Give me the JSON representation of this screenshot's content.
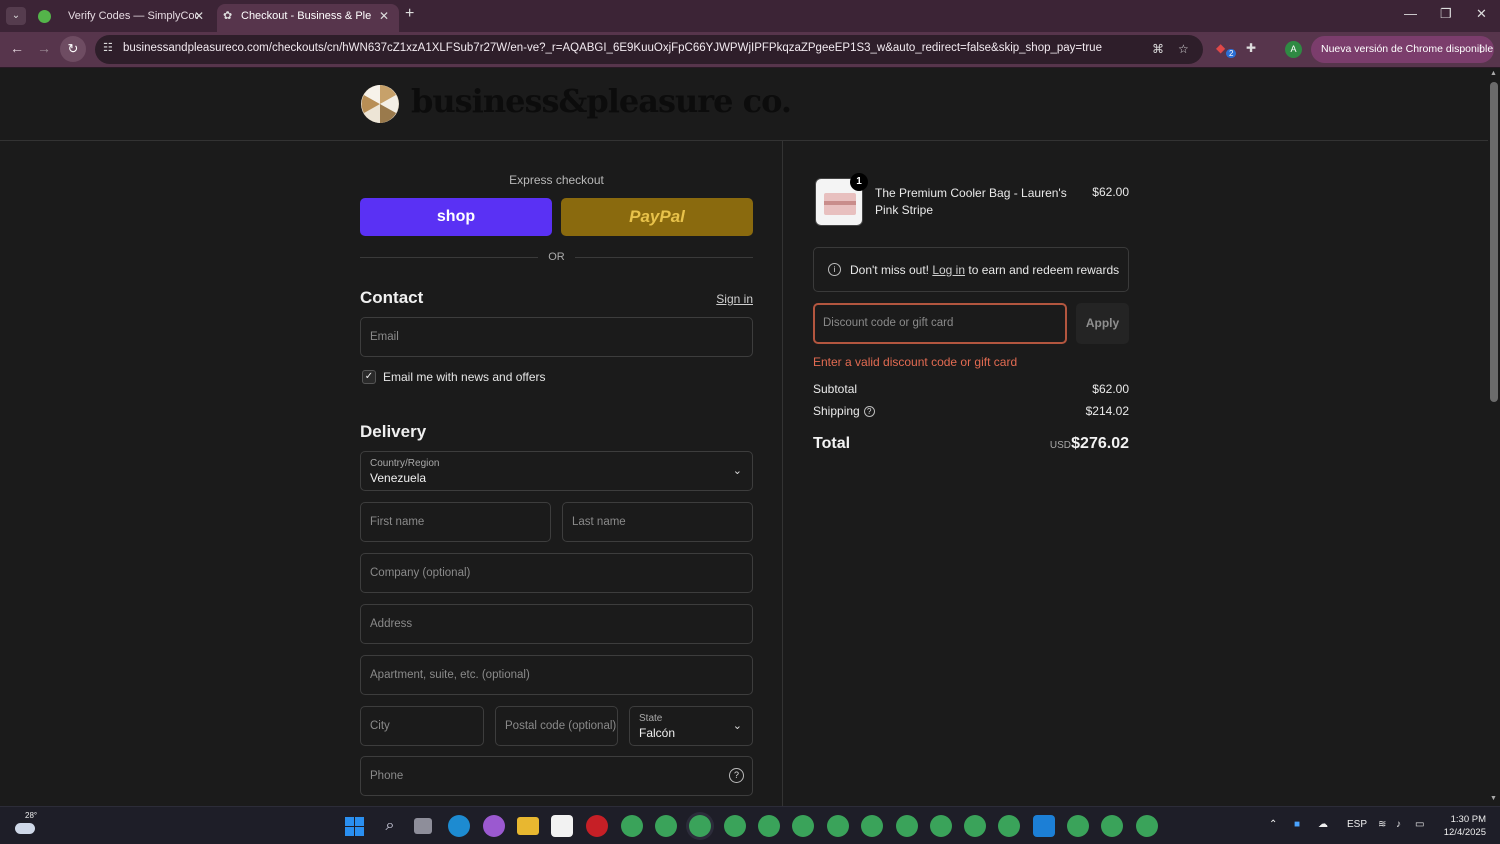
{
  "browser": {
    "tabs": [
      {
        "title": "Verify Codes — SimplyCodes",
        "active": false
      },
      {
        "title": "Checkout - Business & Pleasure",
        "active": true
      }
    ],
    "url": "businessandpleasureco.com/checkouts/cn/hWN637cZ1xzA1XLFSub7r27W/en-ve?_r=AQABGI_6E9KuuOxjFpC66YJWPWjIPFPkqzaZPgeeEP1S3_w&auto_redirect=false&skip_shop_pay=true",
    "update_chip": "Nueva versión de Chrome disponible",
    "profile_initial": "A",
    "extension_badge": "2"
  },
  "store": {
    "logo_text": "business&pleasure co."
  },
  "checkout": {
    "express_label": "Express checkout",
    "shop_label": "shop",
    "paypal_label": "PayPal",
    "or_label": "OR",
    "contact_title": "Contact",
    "sign_in": "Sign in",
    "email_placeholder": "Email",
    "news_label": "Email me with news and offers",
    "delivery_title": "Delivery",
    "country_label": "Country/Region",
    "country_value": "Venezuela",
    "first_name_ph": "First name",
    "last_name_ph": "Last name",
    "company_ph": "Company (optional)",
    "address_ph": "Address",
    "apartment_ph": "Apartment, suite, etc. (optional)",
    "city_ph": "City",
    "postal_ph": "Postal code (optional)",
    "state_label": "State",
    "state_value": "Falcón",
    "phone_ph": "Phone"
  },
  "summary": {
    "item": {
      "qty": "1",
      "name": "The Premium Cooler Bag - Lauren's Pink Stripe",
      "price": "$62.00"
    },
    "rewards_prefix": "Don't miss out!",
    "rewards_link": "Log in",
    "rewards_suffix": "to earn and redeem rewards",
    "discount_ph": "Discount code or gift card",
    "apply_label": "Apply",
    "error": "Enter a valid discount code or gift card",
    "subtotal_label": "Subtotal",
    "subtotal_value": "$62.00",
    "shipping_label": "Shipping",
    "shipping_value": "$214.02",
    "total_label": "Total",
    "total_currency": "USD",
    "total_value": "$276.02"
  },
  "taskbar": {
    "temperature": "28°",
    "language": "ESP",
    "time": "1:30 PM",
    "date": "12/4/2025"
  },
  "colors": {
    "shop": "#5a31f4",
    "paypal": "#8a6a0e",
    "error": "#e36b52",
    "tabstrip": "#3c2436"
  }
}
